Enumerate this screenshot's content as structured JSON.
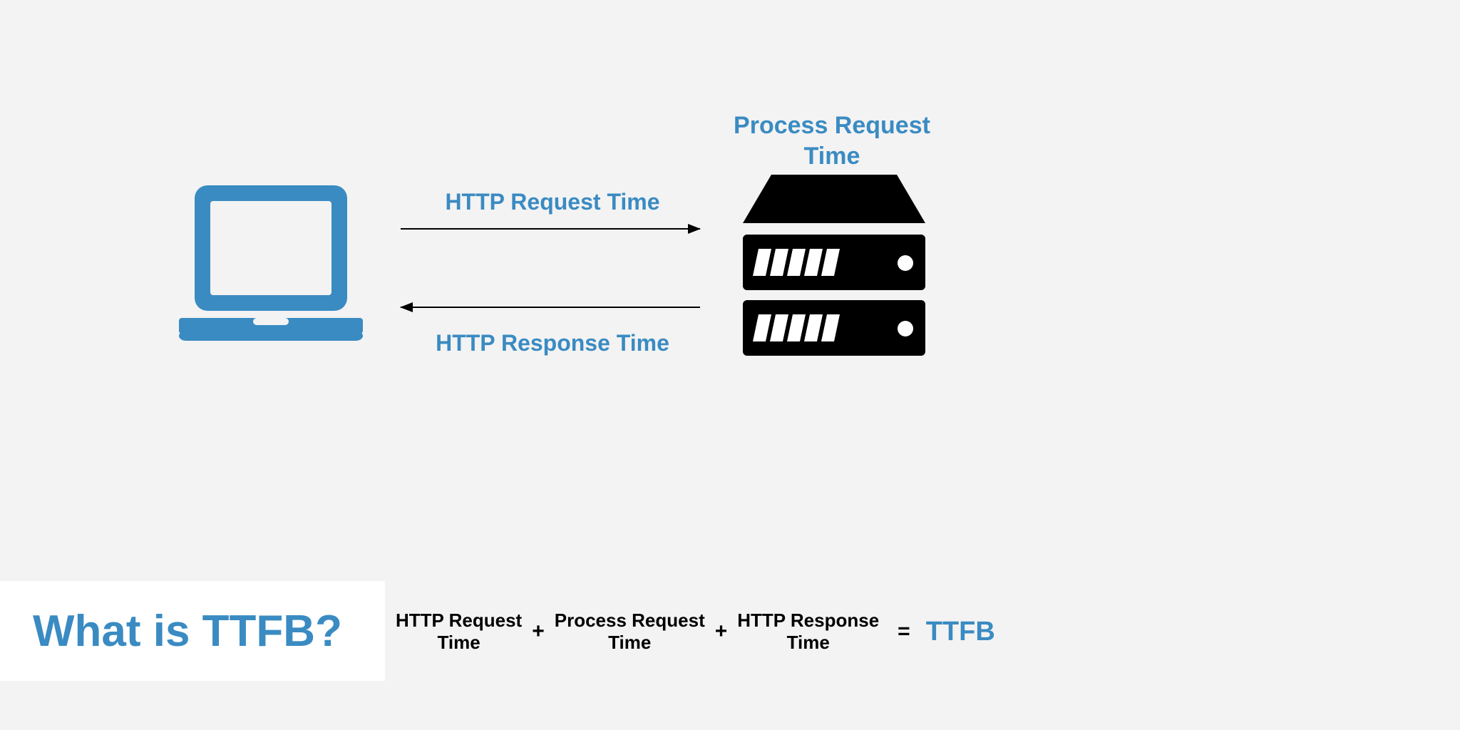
{
  "labels": {
    "process_request_time": "Process Request Time",
    "http_request_time": "HTTP Request Time",
    "http_response_time": "HTTP Response Time"
  },
  "title": "What is TTFB?",
  "formula": {
    "term1": "HTTP Request\nTime",
    "op1": "+",
    "term2": "Process Request\nTime",
    "op2": "+",
    "term3": "HTTP Response\nTime",
    "eq": "=",
    "result": "TTFB"
  },
  "icons": {
    "laptop": "laptop-icon",
    "server": "server-stack-icon",
    "arrow_right": "arrow-right-icon",
    "arrow_left": "arrow-left-icon"
  },
  "colors": {
    "blue": "#3a8bc2",
    "black": "#000000",
    "bg": "#f3f3f3",
    "white": "#ffffff"
  }
}
